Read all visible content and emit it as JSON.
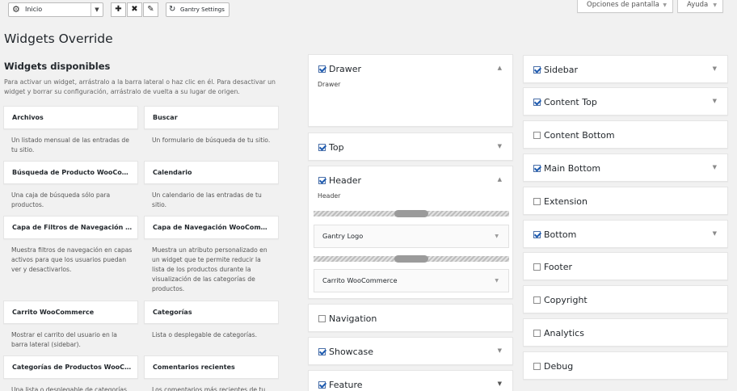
{
  "toolbar": {
    "select_value": "Inicio",
    "gantry_label": "Gantry Settings",
    "screen_options": "Opciones de pantalla",
    "help": "Ayuda"
  },
  "page_title": "Widgets Override",
  "available": {
    "heading": "Widgets disponibles",
    "description": "Para activar un widget, arrástralo a la barra lateral o haz clic en él. Para desactivar un widget y borrar su configuración, arrástralo de vuelta a su lugar de origen.",
    "widgets": [
      {
        "title": "Archivos",
        "desc": "Un listado mensual de las entradas de tu sitio."
      },
      {
        "title": "Buscar",
        "desc": "Un formulario de búsqueda de tu sitio."
      },
      {
        "title": "Búsqueda de Producto WooCommerce",
        "desc": "Una caja de búsqueda sólo para productos."
      },
      {
        "title": "Calendario",
        "desc": "Un calendario de las entradas de tu sitio."
      },
      {
        "title": "Capa de Filtros de Navegación WooCommerce",
        "desc": "Muestra filtros de navegación en capas activos para que los usuarios puedan ver y desactivarlos."
      },
      {
        "title": "Capa de Navegación WooCommerce",
        "desc": "Muestra un atributo personalizado en un widget que te permite reducir la lista de los productos durante la visualización de las categorías de productos."
      },
      {
        "title": "Carrito WooCommerce",
        "desc": "Mostrar el carrito del usuario en la barra lateral (sidebar)."
      },
      {
        "title": "Categorías",
        "desc": "Lista o desplegable de categorías."
      },
      {
        "title": "Categorías de Productos WooCommerce",
        "desc": "Una lista o desplegable de categorías"
      },
      {
        "title": "Comentarios recientes",
        "desc": "Los comentarios más recientes de tu"
      }
    ]
  },
  "middle": {
    "drawer": {
      "title": "Drawer",
      "desc": "Drawer"
    },
    "top": {
      "title": "Top"
    },
    "header": {
      "title": "Header",
      "desc": "Header",
      "widgets": [
        "Gantry Logo",
        "Carrito WooCommerce"
      ]
    },
    "navigation": {
      "title": "Navigation"
    },
    "showcase": {
      "title": "Showcase"
    },
    "feature": {
      "title": "Feature"
    }
  },
  "right": [
    {
      "title": "Sidebar",
      "checked": true
    },
    {
      "title": "Content Top",
      "checked": true
    },
    {
      "title": "Content Bottom",
      "checked": false
    },
    {
      "title": "Main Bottom",
      "checked": true
    },
    {
      "title": "Extension",
      "checked": false
    },
    {
      "title": "Bottom",
      "checked": true
    },
    {
      "title": "Footer",
      "checked": false
    },
    {
      "title": "Copyright",
      "checked": false
    },
    {
      "title": "Analytics",
      "checked": false
    },
    {
      "title": "Debug",
      "checked": false
    }
  ],
  "icons": {
    "gear": "gear-icon",
    "refresh": "refresh-icon",
    "plus": "plus-icon",
    "close": "close-icon",
    "edit": "pencil-icon"
  },
  "colors": {
    "background": "#f1f1f1",
    "checkbox_check": "#1e5bb0"
  }
}
